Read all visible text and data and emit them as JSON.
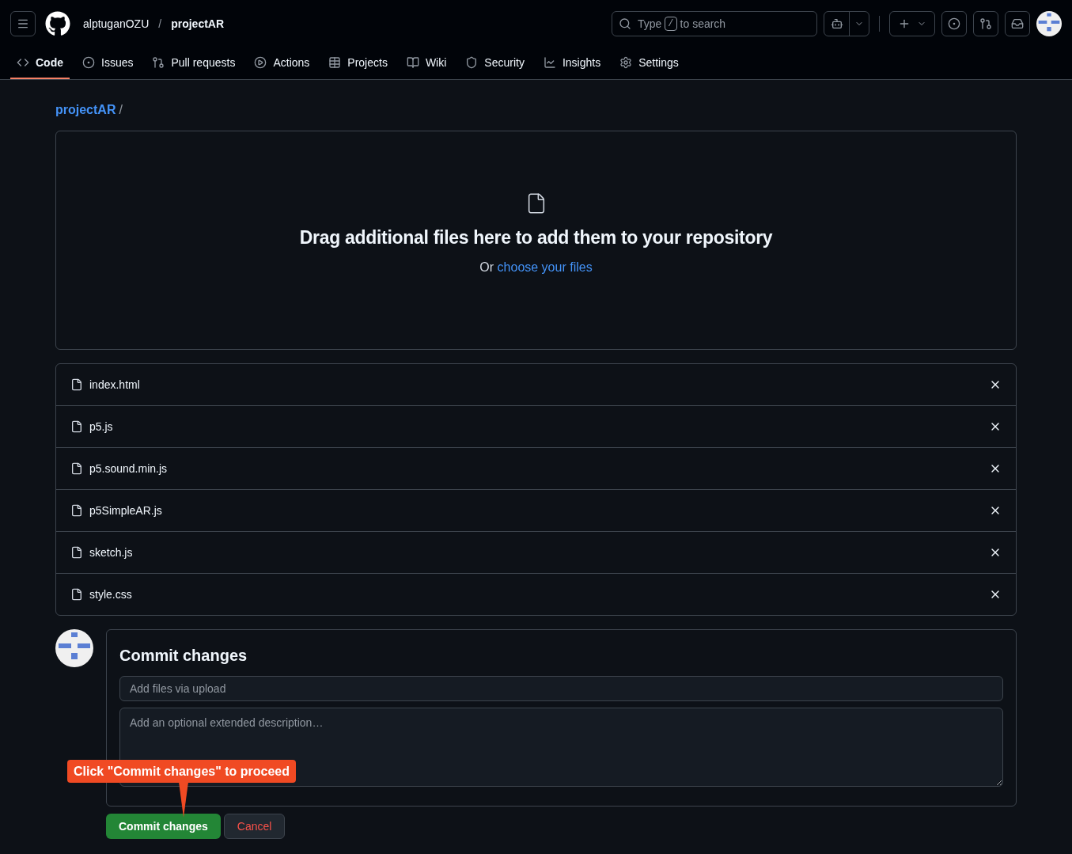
{
  "header": {
    "owner": "alptuganOZU",
    "separator": "/",
    "repo": "projectAR",
    "search": {
      "before": "Type",
      "key": "/",
      "after": "to search"
    }
  },
  "tabs": [
    {
      "label": "Code",
      "kind": "code",
      "selected": true
    },
    {
      "label": "Issues",
      "kind": "issues",
      "selected": false
    },
    {
      "label": "Pull requests",
      "kind": "pulls",
      "selected": false
    },
    {
      "label": "Actions",
      "kind": "actions",
      "selected": false
    },
    {
      "label": "Projects",
      "kind": "projects",
      "selected": false
    },
    {
      "label": "Wiki",
      "kind": "wiki",
      "selected": false
    },
    {
      "label": "Security",
      "kind": "security",
      "selected": false
    },
    {
      "label": "Insights",
      "kind": "insights",
      "selected": false
    },
    {
      "label": "Settings",
      "kind": "settings",
      "selected": false
    }
  ],
  "breadcrumb": {
    "repo": "projectAR",
    "separator": "/"
  },
  "dropzone": {
    "title": "Drag additional files here to add them to your repository",
    "prefix": "Or",
    "link": "choose your files"
  },
  "files": [
    "index.html",
    "p5.js",
    "p5.sound.min.js",
    "p5SimpleAR.js",
    "sketch.js",
    "style.css"
  ],
  "commit": {
    "title": "Commit changes",
    "summary_placeholder": "Add files via upload",
    "description_placeholder": "Add an optional extended description…",
    "submit": "Commit changes",
    "cancel": "Cancel"
  },
  "callout": {
    "text": "Click \"Commit changes\" to proceed"
  }
}
